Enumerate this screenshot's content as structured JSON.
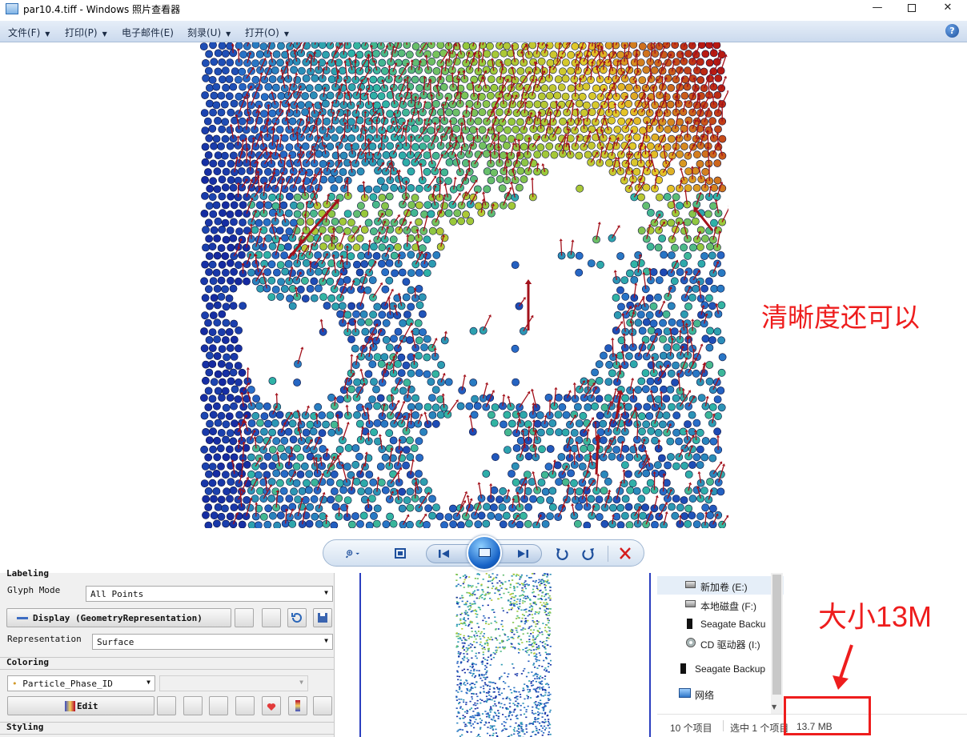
{
  "window": {
    "title": "par10.4.tiff - Windows 照片查看器",
    "minimize_glyph": "—",
    "close_glyph": "✕"
  },
  "menu": {
    "items": [
      {
        "label": "文件(F)",
        "has_arrow": true
      },
      {
        "label": "打印(P)",
        "has_arrow": true
      },
      {
        "label": "电子邮件(E)",
        "has_arrow": false
      },
      {
        "label": "刻录(U)",
        "has_arrow": true
      },
      {
        "label": "打开(O)",
        "has_arrow": true
      }
    ],
    "arrow_glyph": "▼",
    "help_glyph": "?"
  },
  "annotations": {
    "clarity_note": "清晰度还可以",
    "size_note": "大小13M"
  },
  "paraview": {
    "section_labeling": "Labeling",
    "glyph_mode_label": "Glyph Mode",
    "glyph_mode_value": "All Points",
    "display_button": "Display (GeometryRepresentation)",
    "representation_label": "Representation",
    "representation_value": "Surface",
    "section_coloring": "Coloring",
    "coloring_value": "Particle_Phase_ID",
    "edit_button": "Edit",
    "section_styling": "Styling",
    "dropdown_glyph": "▼"
  },
  "explorer": {
    "items": [
      {
        "label": "新加卷 (E:)",
        "selected": true
      },
      {
        "label": "本地磁盘 (F:)",
        "selected": false
      },
      {
        "label": "Seagate Backu",
        "selected": false
      },
      {
        "label": "CD 驱动器 (I:)",
        "selected": false
      },
      {
        "label": "Seagate Backup",
        "selected": false
      },
      {
        "label": "网络",
        "selected": false
      }
    ],
    "scroll_down_glyph": "▼"
  },
  "status": {
    "item_count": "10 个项目",
    "selected_count": "选中 1 个项目",
    "selected_size": "13.7 MB"
  },
  "colors": {
    "annotation_red": "#ee1d1d",
    "menu_gradient_top": "#e6eef8",
    "menu_gradient_bottom": "#cbdaee",
    "particle_low": "#12219c",
    "particle_mid": "#2fb3a6",
    "particle_high": "#b81a12",
    "vector_arrow": "#a3111b"
  },
  "controls": {
    "zoom_icon": "magnifier-icon",
    "fit_icon": "actual-size-icon",
    "prev_icon": "previous-icon",
    "slideshow_icon": "slideshow-icon",
    "next_icon": "next-icon",
    "rotate_ccw_icon": "rotate-counterclockwise-icon",
    "rotate_cw_icon": "rotate-clockwise-icon",
    "delete_icon": "delete-icon"
  }
}
